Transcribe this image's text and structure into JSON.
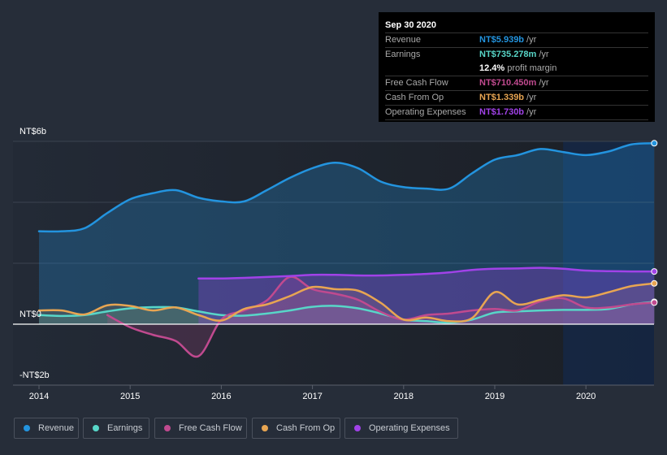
{
  "chart_data": {
    "type": "area",
    "title": "",
    "xlabel": "",
    "ylabel": "",
    "ylim": [
      -2,
      6
    ],
    "xlim": [
      2013.95,
      2020.75
    ],
    "y_tick_labels": [
      {
        "value": 6,
        "label": "NT$6b"
      },
      {
        "value": 0,
        "label": "NT$0"
      },
      {
        "value": -2,
        "label": "-NT$2b"
      }
    ],
    "x_tick_labels": [
      "2014",
      "2015",
      "2016",
      "2017",
      "2018",
      "2019",
      "2020"
    ],
    "x_ticks": [
      2014,
      2015,
      2016,
      2017,
      2018,
      2019,
      2020
    ],
    "highlight_from": 2019.75,
    "units": "NT$ billions",
    "series": [
      {
        "name": "Revenue",
        "color": "#2394df",
        "x": [
          2014.0,
          2014.25,
          2014.5,
          2014.75,
          2015.0,
          2015.25,
          2015.5,
          2015.75,
          2016.0,
          2016.25,
          2016.5,
          2016.75,
          2017.0,
          2017.25,
          2017.5,
          2017.75,
          2018.0,
          2018.25,
          2018.5,
          2018.75,
          2019.0,
          2019.25,
          2019.5,
          2019.75,
          2020.0,
          2020.25,
          2020.5,
          2020.75
        ],
        "values": [
          3.05,
          3.05,
          3.15,
          3.65,
          4.1,
          4.3,
          4.4,
          4.15,
          4.03,
          4.03,
          4.4,
          4.8,
          5.12,
          5.3,
          5.12,
          4.68,
          4.5,
          4.45,
          4.45,
          4.95,
          5.4,
          5.55,
          5.75,
          5.65,
          5.55,
          5.67,
          5.9,
          5.939
        ]
      },
      {
        "name": "Earnings",
        "color": "#58d6c8",
        "x": [
          2014.0,
          2014.25,
          2014.5,
          2014.75,
          2015.0,
          2015.25,
          2015.5,
          2015.75,
          2016.0,
          2016.25,
          2016.5,
          2016.75,
          2017.0,
          2017.25,
          2017.5,
          2017.75,
          2018.0,
          2018.25,
          2018.5,
          2018.75,
          2019.0,
          2019.25,
          2019.5,
          2019.75,
          2020.0,
          2020.25,
          2020.5,
          2020.75
        ],
        "values": [
          0.3,
          0.27,
          0.3,
          0.42,
          0.52,
          0.56,
          0.55,
          0.42,
          0.3,
          0.28,
          0.35,
          0.45,
          0.57,
          0.6,
          0.52,
          0.35,
          0.15,
          0.1,
          0.05,
          0.15,
          0.38,
          0.42,
          0.45,
          0.47,
          0.47,
          0.5,
          0.65,
          0.735
        ]
      },
      {
        "name": "Free Cash Flow",
        "color": "#c04a8f",
        "x": [
          2014.75,
          2015.0,
          2015.25,
          2015.5,
          2015.75,
          2016.0,
          2016.25,
          2016.5,
          2016.75,
          2017.0,
          2017.25,
          2017.5,
          2017.75,
          2018.0,
          2018.25,
          2018.5,
          2018.75,
          2019.0,
          2019.25,
          2019.5,
          2019.75,
          2020.0,
          2020.25,
          2020.5,
          2020.75
        ],
        "values": [
          0.3,
          -0.1,
          -0.35,
          -0.55,
          -1.05,
          0.15,
          0.45,
          0.78,
          1.55,
          1.15,
          1.0,
          0.8,
          0.4,
          0.15,
          0.3,
          0.35,
          0.45,
          0.5,
          0.45,
          0.75,
          0.85,
          0.55,
          0.55,
          0.65,
          0.71
        ]
      },
      {
        "name": "Cash From Op",
        "color": "#e8a552",
        "x": [
          2014.0,
          2014.25,
          2014.5,
          2014.75,
          2015.0,
          2015.25,
          2015.5,
          2015.75,
          2016.0,
          2016.25,
          2016.5,
          2016.75,
          2017.0,
          2017.25,
          2017.5,
          2017.75,
          2018.0,
          2018.25,
          2018.5,
          2018.75,
          2019.0,
          2019.25,
          2019.5,
          2019.75,
          2020.0,
          2020.25,
          2020.5,
          2020.75
        ],
        "values": [
          0.45,
          0.45,
          0.32,
          0.62,
          0.6,
          0.45,
          0.55,
          0.3,
          0.12,
          0.5,
          0.65,
          0.92,
          1.22,
          1.15,
          1.1,
          0.7,
          0.15,
          0.22,
          0.1,
          0.2,
          1.05,
          0.65,
          0.8,
          0.95,
          0.88,
          1.05,
          1.25,
          1.339
        ]
      },
      {
        "name": "Operating Expenses",
        "color": "#a142e8",
        "x": [
          2015.75,
          2016.0,
          2016.25,
          2016.5,
          2016.75,
          2017.0,
          2017.25,
          2017.5,
          2017.75,
          2018.0,
          2018.25,
          2018.5,
          2018.75,
          2019.0,
          2019.25,
          2019.5,
          2019.75,
          2020.0,
          2020.25,
          2020.5,
          2020.75
        ],
        "values": [
          1.5,
          1.5,
          1.52,
          1.55,
          1.58,
          1.62,
          1.62,
          1.6,
          1.6,
          1.62,
          1.65,
          1.7,
          1.78,
          1.82,
          1.83,
          1.85,
          1.82,
          1.76,
          1.74,
          1.73,
          1.73
        ]
      }
    ]
  },
  "tooltip": {
    "date": "Sep 30 2020",
    "rows": [
      {
        "label": "Revenue",
        "value": "NT$5.939b",
        "unit": "/yr",
        "color": "#2394df"
      },
      {
        "label": "Earnings",
        "value": "NT$735.278m",
        "unit": "/yr",
        "color": "#58d6c8"
      },
      {
        "label": "",
        "value": "12.4%",
        "unit": "profit margin",
        "color": "#ffffff"
      },
      {
        "label": "Free Cash Flow",
        "value": "NT$710.450m",
        "unit": "/yr",
        "color": "#c04a8f"
      },
      {
        "label": "Cash From Op",
        "value": "NT$1.339b",
        "unit": "/yr",
        "color": "#e8a552"
      },
      {
        "label": "Operating Expenses",
        "value": "NT$1.730b",
        "unit": "/yr",
        "color": "#a142e8"
      }
    ]
  },
  "legend": [
    {
      "label": "Revenue",
      "color": "#2394df"
    },
    {
      "label": "Earnings",
      "color": "#58d6c8"
    },
    {
      "label": "Free Cash Flow",
      "color": "#c04a8f"
    },
    {
      "label": "Cash From Op",
      "color": "#e8a552"
    },
    {
      "label": "Operating Expenses",
      "color": "#a142e8"
    }
  ]
}
